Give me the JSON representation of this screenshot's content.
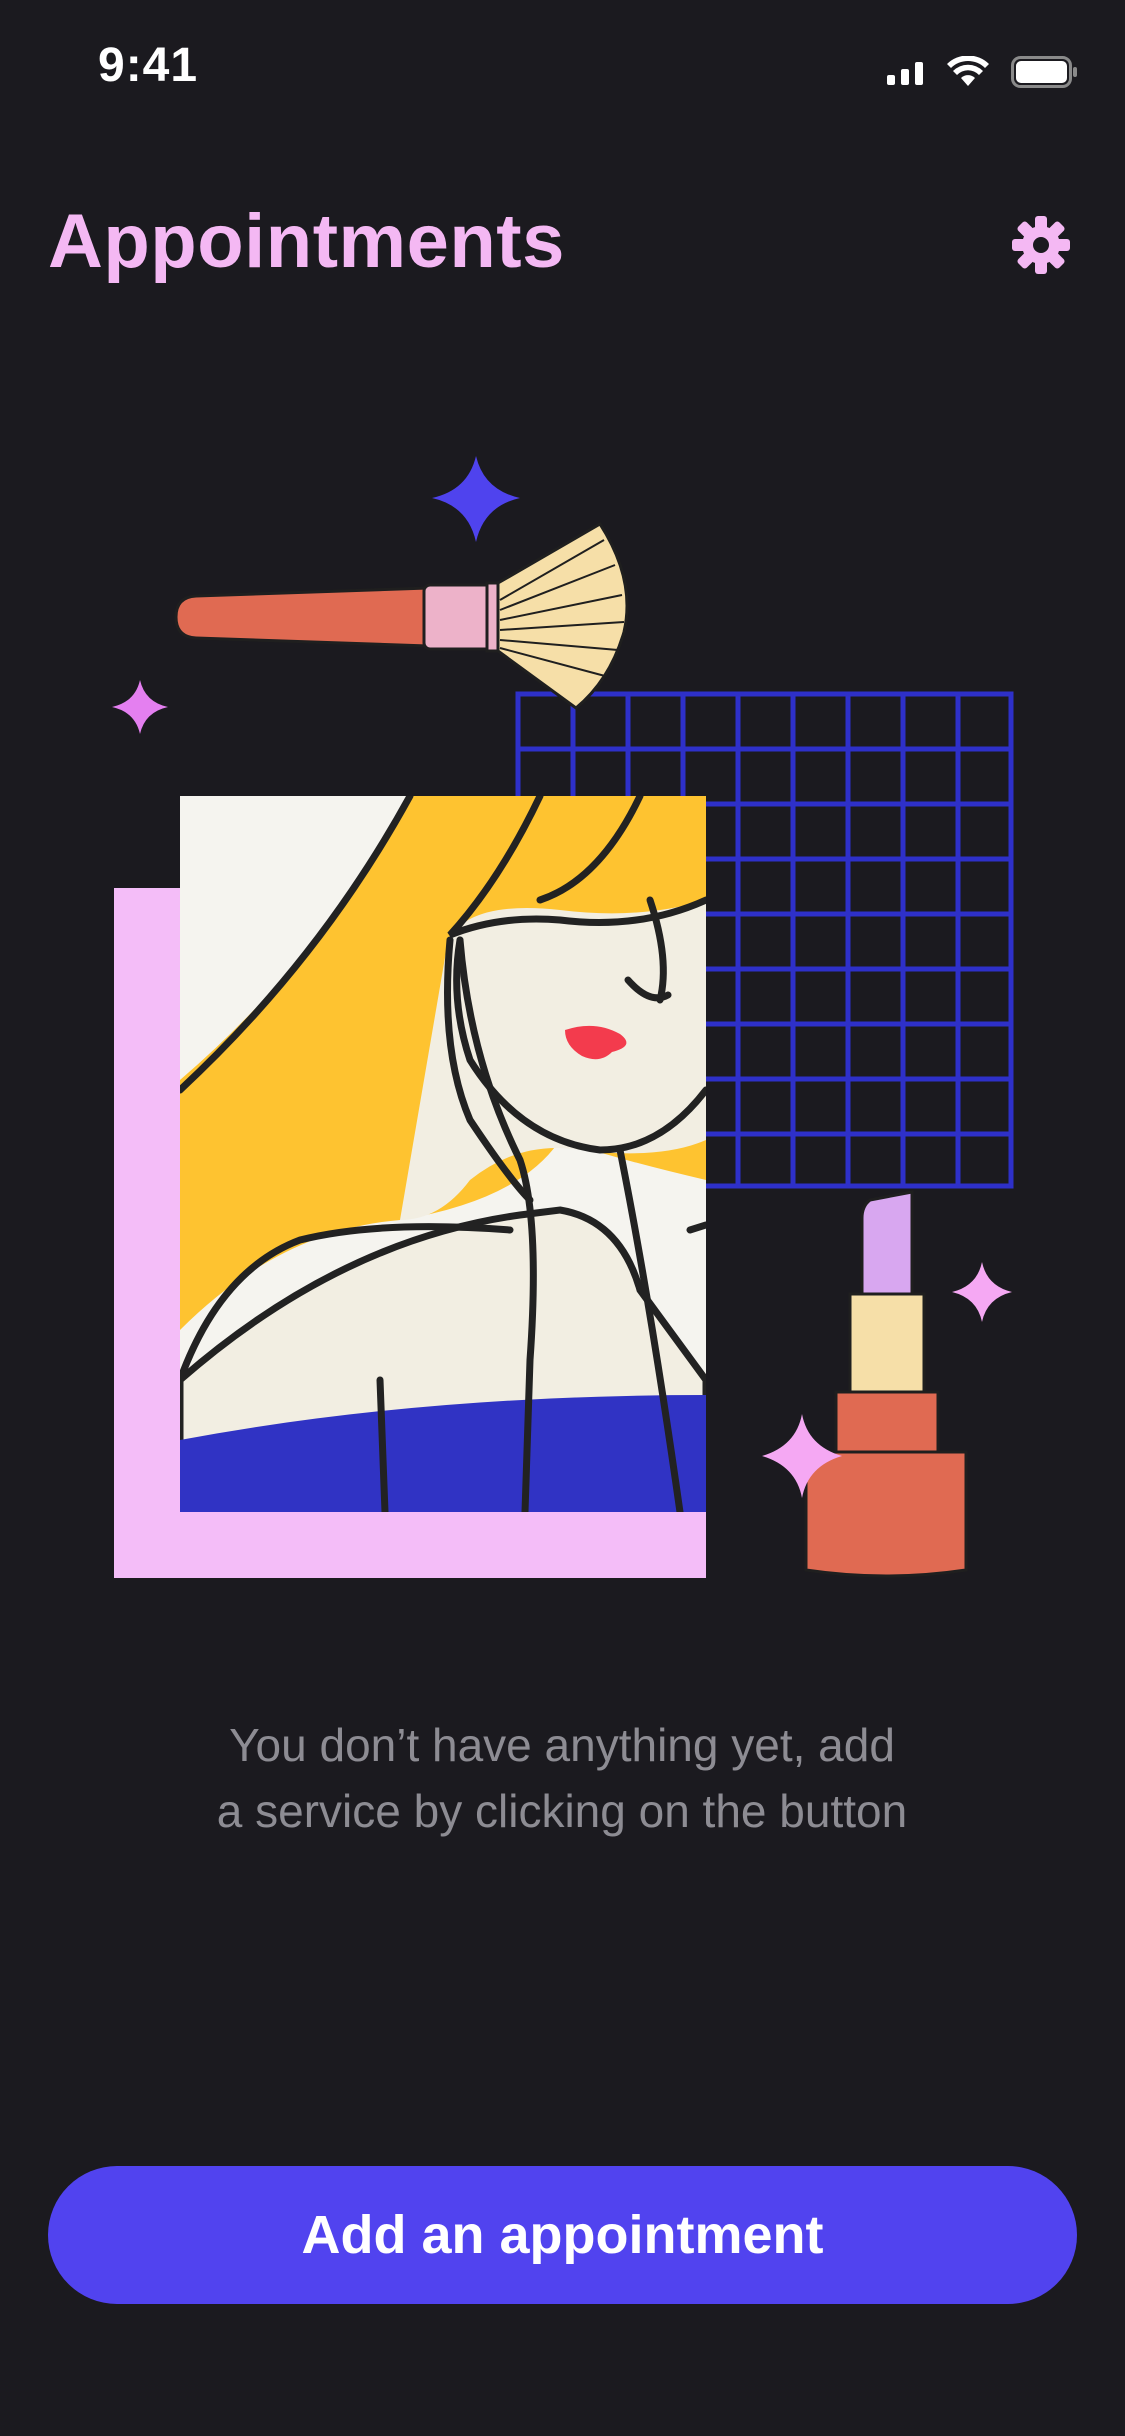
{
  "status_bar": {
    "time": "9:41",
    "icons": [
      "cellular-signal-icon",
      "wifi-icon",
      "battery-icon"
    ]
  },
  "header": {
    "title": "Appointments",
    "settings_icon": "gear-icon"
  },
  "empty_state": {
    "line1": "You don’t have anything yet, add",
    "line2": "a service by clicking on the button",
    "illustration_icons": [
      "makeup-brush-icon",
      "lipstick-icon",
      "sparkle-icon",
      "grid-decoration",
      "portrait-illustration"
    ]
  },
  "primary_action": {
    "label": "Add an appointment"
  },
  "colors": {
    "background": "#1b1a1f",
    "title": "#f4b8f3",
    "accent": "#5143ef",
    "muted_text": "#8d8c93"
  }
}
